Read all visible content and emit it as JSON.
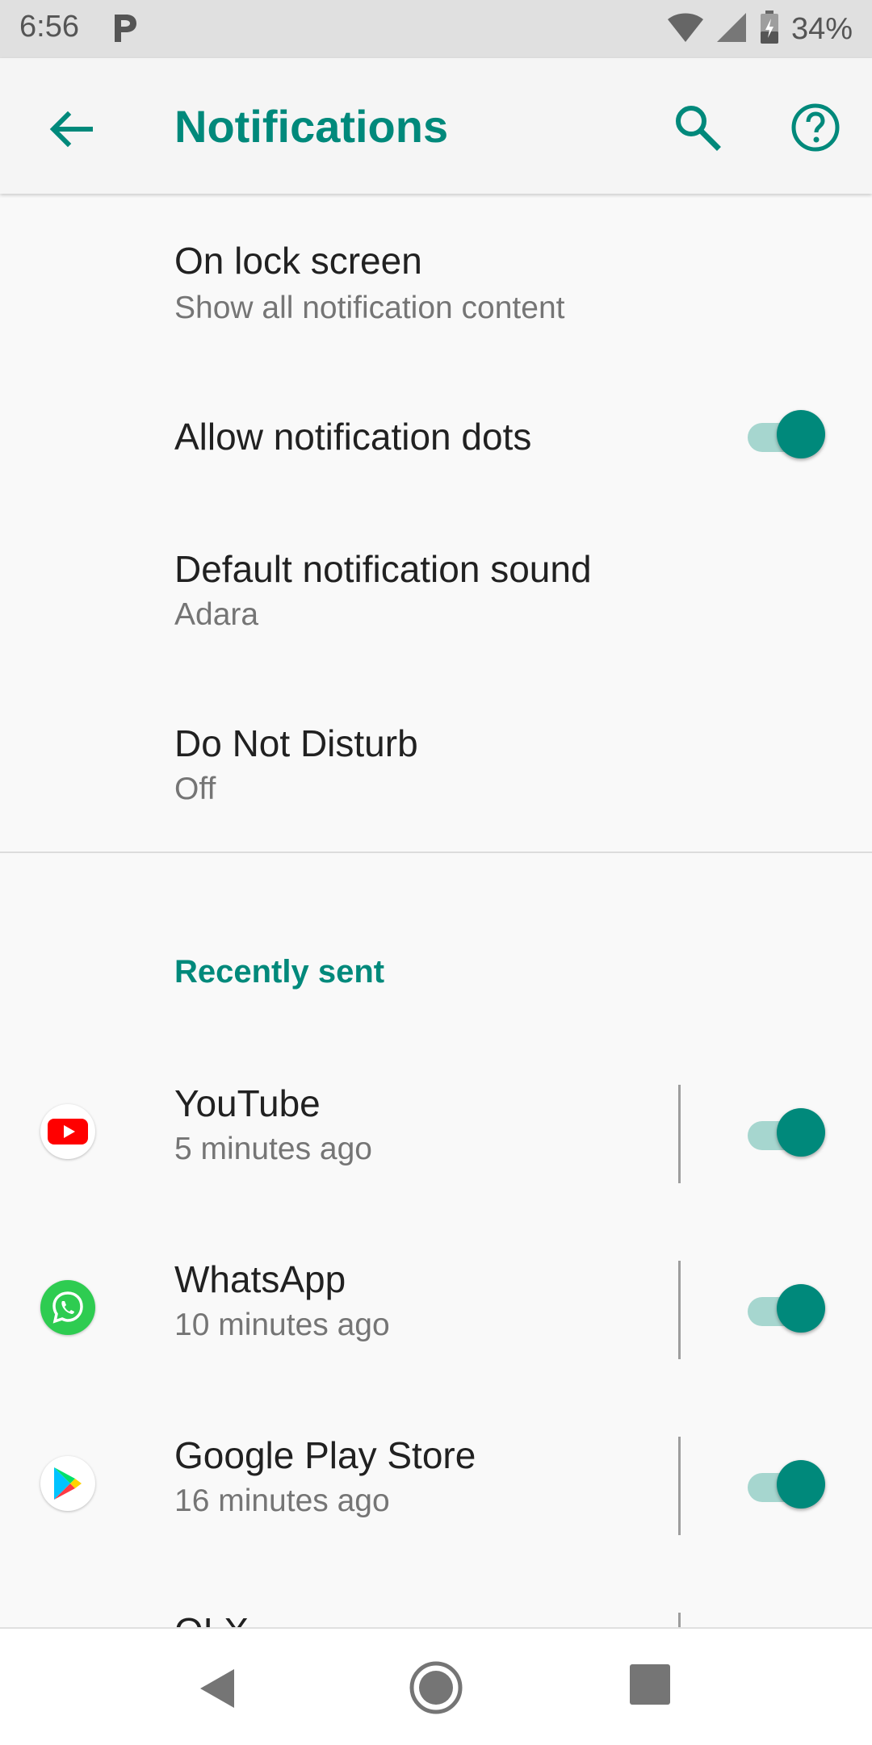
{
  "status_bar": {
    "time": "6:56",
    "battery": "34%"
  },
  "app_bar": {
    "title": "Notifications"
  },
  "settings": [
    {
      "title": "On lock screen",
      "subtitle": "Show all notification content"
    },
    {
      "title": "Allow notification dots",
      "toggle": true
    },
    {
      "title": "Default notification sound",
      "subtitle": "Adara"
    },
    {
      "title": "Do Not Disturb",
      "subtitle": "Off"
    }
  ],
  "recently_sent": {
    "header": "Recently sent",
    "apps": [
      {
        "name": "YouTube",
        "time": "5 minutes ago",
        "enabled": true,
        "icon": "youtube-icon"
      },
      {
        "name": "WhatsApp",
        "time": "10 minutes ago",
        "enabled": true,
        "icon": "whatsapp-icon"
      },
      {
        "name": "Google Play Store",
        "time": "16 minutes ago",
        "enabled": true,
        "icon": "google-play-icon"
      },
      {
        "name": "OLX",
        "time": "",
        "enabled": true,
        "icon": "olx-icon"
      }
    ]
  },
  "colors": {
    "accent": "#00897b",
    "toggle_track": "#a6d6cf"
  }
}
